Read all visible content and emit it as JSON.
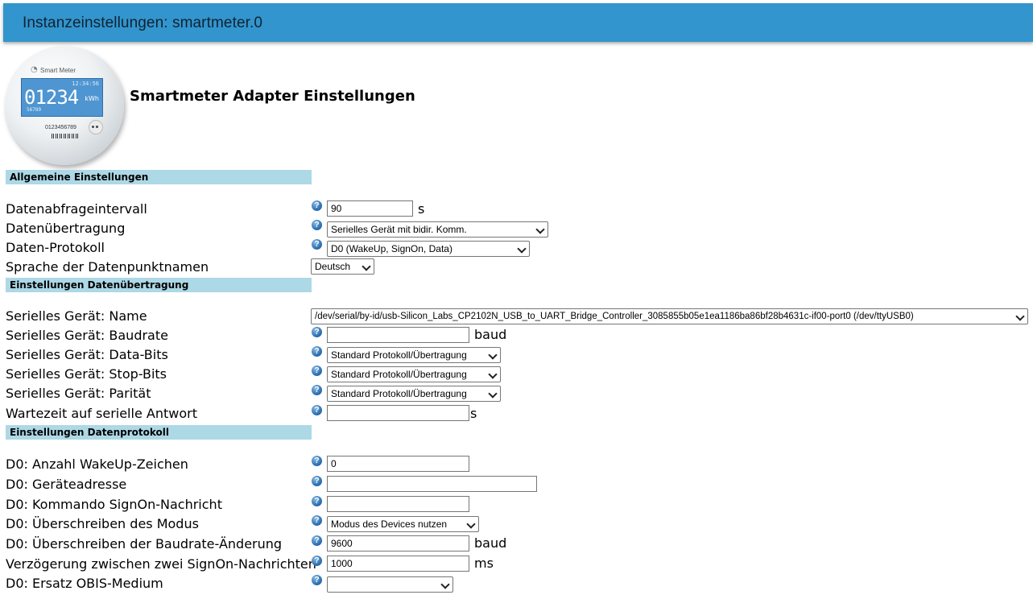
{
  "window": {
    "title": "Instanzeinstellungen: smartmeter.0"
  },
  "logo": {
    "brand": "Smart Meter",
    "time": "12:34:56",
    "reading": "01234",
    "unit": "kWh",
    "sub": "56789",
    "serial": "0123456789"
  },
  "heading": "Smartmeter Adapter Einstellungen",
  "sections": {
    "general": "Allgemeine Einstellungen",
    "transfer": "Einstellungen Datenübertragung",
    "protocol": "Einstellungen Datenprotokoll"
  },
  "fields": {
    "interval": {
      "label": "Datenabfrageintervall",
      "value": "90",
      "unit": "s"
    },
    "transfer": {
      "label": "Datenübertragung",
      "value": "Serielles Gerät mit bidir. Komm."
    },
    "protocol": {
      "label": "Daten-Protokoll",
      "value": "D0 (WakeUp, SignOn, Data)"
    },
    "language": {
      "label": "Sprache der Datenpunktnamen",
      "value": "Deutsch"
    },
    "serial_name": {
      "label": "Serielles Gerät: Name",
      "value": "/dev/serial/by-id/usb-Silicon_Labs_CP2102N_USB_to_UART_Bridge_Controller_3085855b05e1ea1186ba86bf28b4631c-if00-port0 (/dev/ttyUSB0)"
    },
    "baudrate": {
      "label": "Serielles Gerät: Baudrate",
      "value": "",
      "unit": "baud"
    },
    "databits": {
      "label": "Serielles Gerät: Data-Bits",
      "value": "Standard Protokoll/Übertragung"
    },
    "stopbits": {
      "label": "Serielles Gerät: Stop-Bits",
      "value": "Standard Protokoll/Übertragung"
    },
    "parity": {
      "label": "Serielles Gerät: Parität",
      "value": "Standard Protokoll/Übertragung"
    },
    "wait": {
      "label": "Wartezeit auf serielle Antwort",
      "value": "",
      "unit": "s"
    },
    "wakeup": {
      "label": "D0: Anzahl WakeUp-Zeichen",
      "value": "0"
    },
    "address": {
      "label": "D0: Geräteadresse",
      "value": ""
    },
    "signon": {
      "label": "D0: Kommando SignOn-Nachricht",
      "value": ""
    },
    "mode": {
      "label": "D0: Überschreiben des Modus",
      "value": "Modus des Devices nutzen"
    },
    "baudchange": {
      "label": "D0: Überschreiben der Baudrate-Änderung",
      "value": "9600",
      "unit": "baud"
    },
    "delay": {
      "label": "Verzögerung zwischen zwei SignOn-Nachrichten",
      "value": "1000",
      "unit": "ms"
    },
    "obis": {
      "label": "D0: Ersatz OBIS-Medium",
      "value": ""
    }
  },
  "help_icon": {
    "glyph": "?"
  }
}
